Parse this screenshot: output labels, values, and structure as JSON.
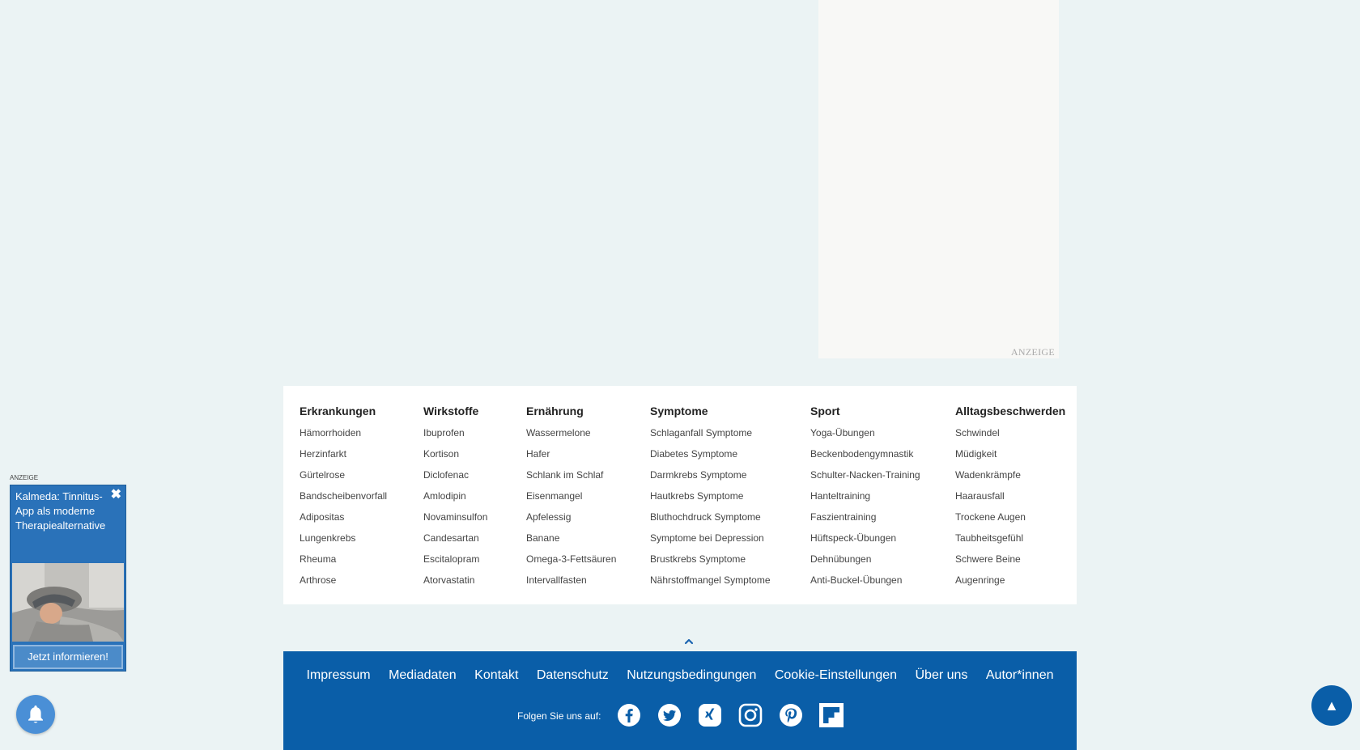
{
  "top_ad": {
    "label": "ANZEIGE"
  },
  "columns": [
    {
      "title": "Erkrankungen",
      "items": [
        "Hämorrhoiden",
        "Herzinfarkt",
        "Gürtelrose",
        "Bandscheibenvorfall",
        "Adipositas",
        "Lungenkrebs",
        "Rheuma",
        "Arthrose"
      ]
    },
    {
      "title": "Wirkstoffe",
      "items": [
        "Ibuprofen",
        "Kortison",
        "Diclofenac",
        "Amlodipin",
        "Novaminsulfon",
        "Candesartan",
        "Escitalopram",
        "Atorvastatin"
      ]
    },
    {
      "title": "Ernährung",
      "items": [
        "Wassermelone",
        "Hafer",
        "Schlank im Schlaf",
        "Eisenmangel",
        "Apfelessig",
        "Banane",
        "Omega-3-Fettsäuren",
        "Intervallfasten"
      ]
    },
    {
      "title": "Symptome",
      "items": [
        "Schlaganfall Symptome",
        "Diabetes Symptome",
        "Darmkrebs Symptome",
        "Hautkrebs Symptome",
        "Bluthochdruck Symptome",
        "Symptome bei Depression",
        "Brustkrebs Symptome",
        "Nährstoffmangel Symptome"
      ]
    },
    {
      "title": "Sport",
      "items": [
        "Yoga-Übungen",
        "Beckenbodengymnastik",
        "Schulter-Nacken-Training",
        "Hanteltraining",
        "Faszientraining",
        "Hüftspeck-Übungen",
        "Dehnübungen",
        "Anti-Buckel-Übungen"
      ]
    },
    {
      "title": "Alltagsbeschwerden",
      "items": [
        "Schwindel",
        "Müdigkeit",
        "Wadenkrämpfe",
        "Haarausfall",
        "Trockene Augen",
        "Taubheitsgefühl",
        "Schwere Beine",
        "Augenringe"
      ]
    }
  ],
  "footer": {
    "links": [
      "Impressum",
      "Mediadaten",
      "Kontakt",
      "Datenschutz",
      "Nutzungsbedingungen",
      "Cookie-Einstellungen",
      "Über uns",
      "Autor*innen"
    ],
    "follow_label": "Folgen Sie uns auf:",
    "social_icons": [
      "facebook-icon",
      "twitter-icon",
      "xing-icon",
      "instagram-icon",
      "pinterest-icon",
      "flipboard-icon"
    ]
  },
  "side_ad": {
    "label": "ANZEIGE",
    "title": "Kalmeda: Tinnitus-App als moderne Therapiealternative",
    "close_glyph": "✖",
    "button": "Jetzt informieren!"
  },
  "scroll_top_glyph": "▲",
  "colors": {
    "footer_bg": "#0a5ea8",
    "page_bg": "#ebf3f4",
    "bell_bg": "#4a8fd6"
  }
}
